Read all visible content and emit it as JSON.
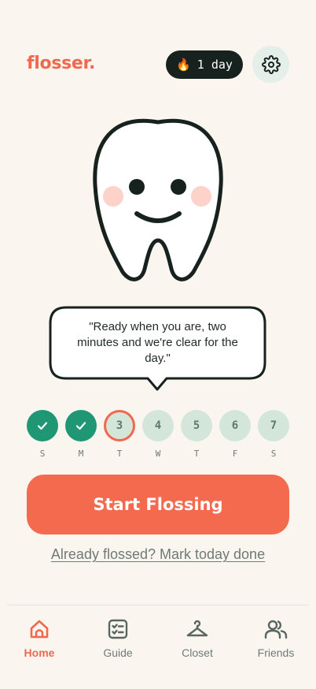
{
  "header": {
    "logo": "flosser.",
    "streak_icon": "flame-icon",
    "streak_label": "1 day",
    "settings_icon": "gear-icon"
  },
  "mascot": {
    "speech": "\"Ready when you are, two minutes and we're clear for the day.\""
  },
  "week": {
    "days": [
      {
        "letter": "S",
        "value": "",
        "status": "done"
      },
      {
        "letter": "M",
        "value": "",
        "status": "done"
      },
      {
        "letter": "T",
        "value": "3",
        "status": "today"
      },
      {
        "letter": "W",
        "value": "4",
        "status": "upcoming"
      },
      {
        "letter": "T",
        "value": "5",
        "status": "upcoming"
      },
      {
        "letter": "F",
        "value": "6",
        "status": "upcoming"
      },
      {
        "letter": "S",
        "value": "7",
        "status": "upcoming"
      }
    ]
  },
  "actions": {
    "start_label": "Start Flossing",
    "mark_done_label": "Already flossed? Mark today done"
  },
  "tabs": [
    {
      "label": "Home",
      "icon": "home-icon",
      "active": true
    },
    {
      "label": "Guide",
      "icon": "checklist-icon",
      "active": false
    },
    {
      "label": "Closet",
      "icon": "hanger-icon",
      "active": false
    },
    {
      "label": "Friends",
      "icon": "friends-icon",
      "active": false
    }
  ],
  "colors": {
    "background": "#faf6ef",
    "accent": "#f46a4f",
    "done_green": "#1f9774",
    "pending_mint": "#d4e6da",
    "dark": "#17221f"
  }
}
